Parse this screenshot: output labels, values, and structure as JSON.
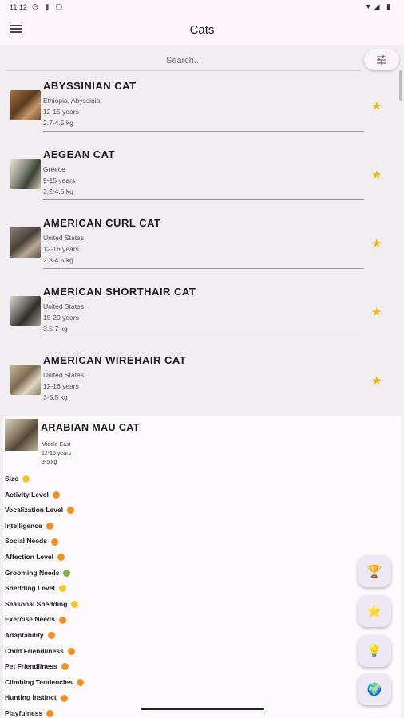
{
  "status_bar": {
    "time": "11:12",
    "left_icons": "◷ ▮ ▢",
    "right_icons": "▼◢ ▮"
  },
  "app_bar": {
    "title": "Cats"
  },
  "search": {
    "placeholder": "Search..."
  },
  "breeds": [
    {
      "name": "ABYSSINIAN CAT",
      "origin": "Ethiopia, Abyssinia",
      "lifespan": "12-15 years",
      "weight": "2.7-4.5 kg"
    },
    {
      "name": "AEGEAN CAT",
      "origin": "Greece",
      "lifespan": "9-15 years",
      "weight": "3.2-4.5 kg"
    },
    {
      "name": "AMERICAN CURL CAT",
      "origin": "United States",
      "lifespan": "12-16 years",
      "weight": "2.3-4.5 kg"
    },
    {
      "name": "AMERICAN SHORTHAIR CAT",
      "origin": "United States",
      "lifespan": "15-20 years",
      "weight": "3.5-7 kg"
    },
    {
      "name": "AMERICAN WIREHAIR CAT",
      "origin": "United States",
      "lifespan": "12-16 years",
      "weight": "3-5.5 kg"
    }
  ],
  "detail": {
    "name": "ARABIAN MAU CAT",
    "origin": "Middle East",
    "lifespan": "12-16 years",
    "weight": "3-5 kg",
    "traits": [
      {
        "label": "Size",
        "color": "#f7c52b"
      },
      {
        "label": "Activity Level",
        "color": "#f5901e"
      },
      {
        "label": "Vocalization Level",
        "color": "#f5901e"
      },
      {
        "label": "Intelligence",
        "color": "#f5901e"
      },
      {
        "label": "Social Needs",
        "color": "#f5901e"
      },
      {
        "label": "Affection Level",
        "color": "#f5901e"
      },
      {
        "label": "Grooming Needs",
        "color": "#7cb342"
      },
      {
        "label": "Shedding Level",
        "color": "#f7c52b"
      },
      {
        "label": "Seasonal Shedding",
        "color": "#f7c52b"
      },
      {
        "label": "Exercise Needs",
        "color": "#f5901e"
      },
      {
        "label": "Adaptability",
        "color": "#f5901e"
      },
      {
        "label": "Child Friendliness",
        "color": "#f5901e"
      },
      {
        "label": "Pet Friendliness",
        "color": "#f5901e"
      },
      {
        "label": "Climbing Tendencies",
        "color": "#f5901e"
      },
      {
        "label": "Hunting Instinct",
        "color": "#f5901e"
      },
      {
        "label": "Playfulness",
        "color": "#f5901e"
      }
    ]
  },
  "fabs": [
    {
      "icon": "trophy-icon",
      "glyph": "🏆"
    },
    {
      "icon": "star-icon",
      "glyph": "⭐"
    },
    {
      "icon": "lightbulb-icon",
      "glyph": "💡"
    },
    {
      "icon": "globe-icon",
      "glyph": "🌍"
    }
  ],
  "colors": {
    "accent_star": "#f5b800",
    "background": "#fdf7fc",
    "list_bg": "#f0eef0"
  }
}
